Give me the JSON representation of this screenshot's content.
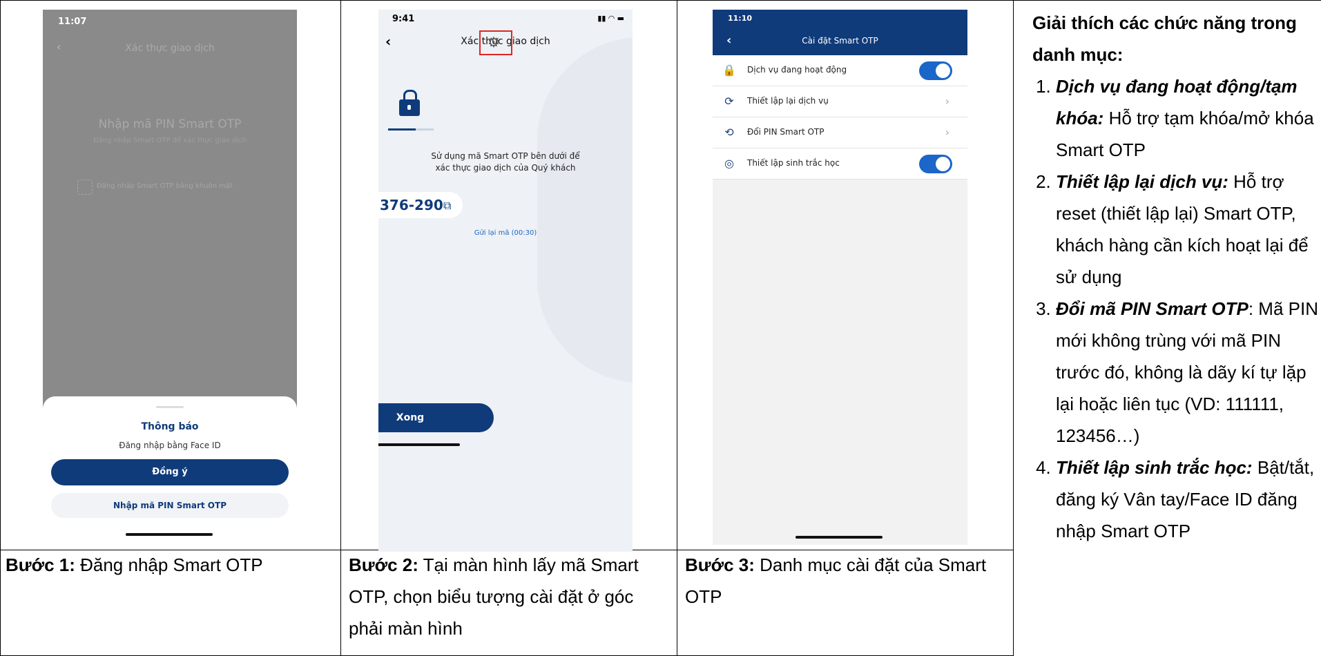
{
  "steps": [
    {
      "label": "Bước 1:",
      "text": " Đăng nhập Smart OTP"
    },
    {
      "label": "Bước 2:",
      "text": " Tại màn hình lấy mã Smart OTP, chọn biểu tượng cài đặt ở góc phải màn hình"
    },
    {
      "label": "Bước 3:",
      "text": " Danh mục cài đặt của Smart OTP"
    }
  ],
  "phone1": {
    "time": "11:07",
    "header": "Xác thực giao dịch",
    "pin_title": "Nhập mã PIN Smart OTP",
    "pin_sub": "Đăng nhập Smart OTP để xác thực giao dịch",
    "faceid_link": "Đăng nhập Smart OTP bằng khuôn mặt",
    "sheet_title": "Thông báo",
    "sheet_msg": "Đăng nhập bằng Face ID",
    "agree": "Đồng ý",
    "enter_pin": "Nhập mã PIN Smart OTP"
  },
  "phone2": {
    "time": "9:41",
    "header": "Xác thực giao dịch",
    "desc1": "Sử dụng mã Smart OTP bên dưới để",
    "desc2": "xác thực giao dịch của Quý khách",
    "code": "376-290",
    "resend": "Gửi lại mã (00:30)",
    "done": "Xong"
  },
  "phone3": {
    "time": "11:10",
    "header": "Cài đặt Smart OTP",
    "rows": [
      {
        "label": "Dịch vụ đang hoạt động",
        "icon": "lock-icon",
        "control": "toggle"
      },
      {
        "label": "Thiết lập lại dịch vụ",
        "icon": "refresh-icon",
        "control": "chevron"
      },
      {
        "label": "Đổi PIN Smart OTP",
        "icon": "change-pin-icon",
        "control": "chevron"
      },
      {
        "label": "Thiết lập sinh trắc học",
        "icon": "fingerprint-icon",
        "control": "toggle"
      }
    ]
  },
  "explain": {
    "heading": "Giải thích các chức năng trong danh mục:",
    "items": [
      {
        "term": "Dịch vụ đang hoạt động/tạm khóa:",
        "desc": " Hỗ trợ tạm khóa/mở khóa Smart OTP"
      },
      {
        "term": "Thiết lập lại dịch vụ:",
        "desc": " Hỗ trợ reset (thiết lập lại) Smart OTP, khách hàng cần kích hoạt lại để sử dụng"
      },
      {
        "term": "Đổi mã PIN Smart OTP",
        "desc": ": Mã PIN mới không trùng với mã PIN trước đó, không là dãy kí tự lặp lại hoặc liên tục (VD: 111111, 123456…)"
      },
      {
        "term": "Thiết lập sinh trắc học:",
        "desc": " Bật/tắt, đăng ký Vân tay/Face ID đăng nhập Smart OTP"
      }
    ]
  },
  "colors": {
    "navy": "#0f3b7a",
    "blue": "#1a66c9",
    "highlight": "#e02424"
  }
}
